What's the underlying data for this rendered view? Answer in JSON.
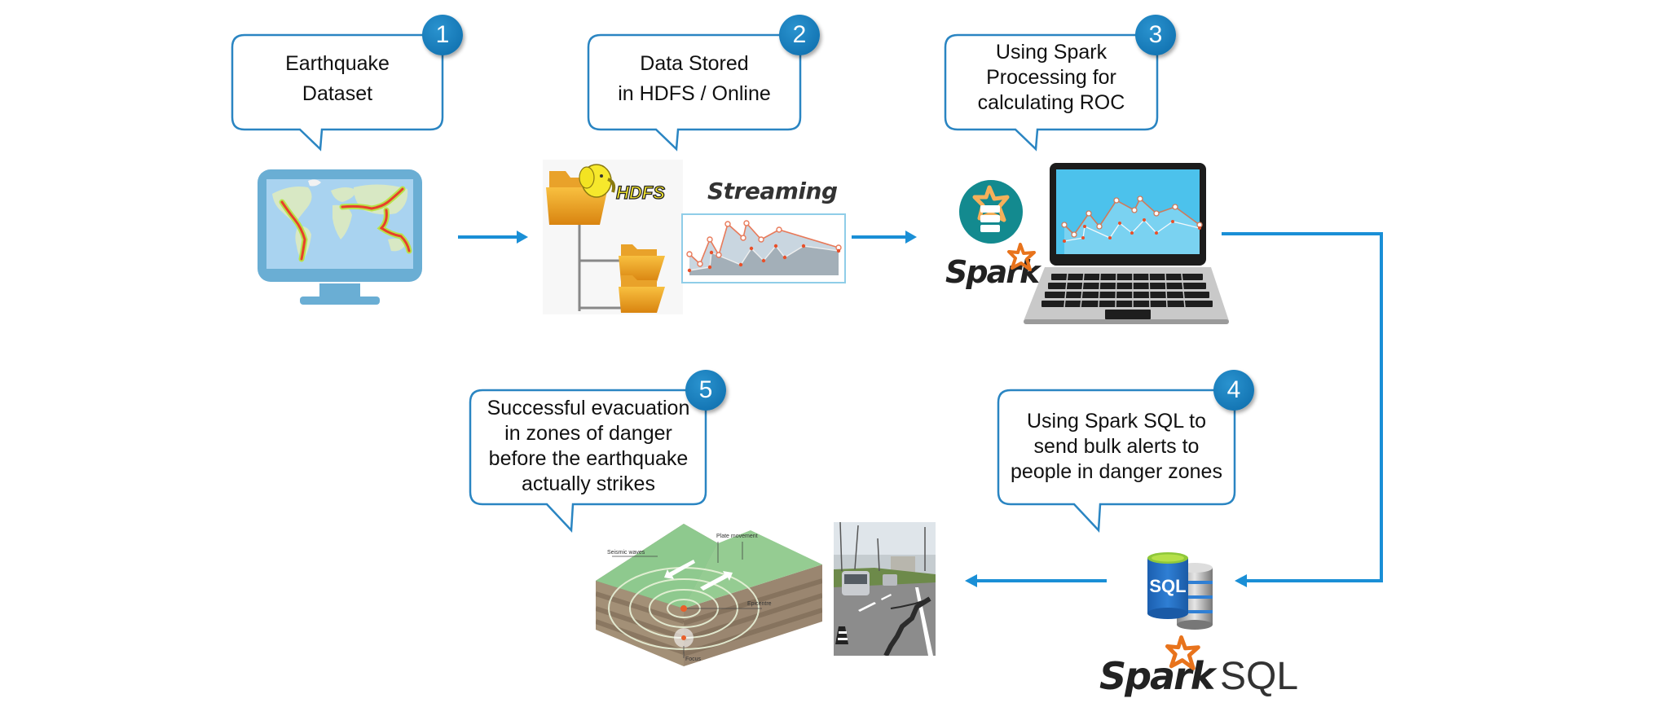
{
  "steps": [
    {
      "number": "1",
      "lines": [
        "Earthquake",
        "Dataset"
      ]
    },
    {
      "number": "2",
      "lines": [
        "Data Stored",
        "in HDFS / Online"
      ]
    },
    {
      "number": "3",
      "lines": [
        "Using Spark",
        "Processing for",
        "calculating ROC"
      ]
    },
    {
      "number": "4",
      "lines": [
        "Using Spark SQL to",
        "send bulk alerts to",
        "people in danger zones"
      ]
    },
    {
      "number": "5",
      "lines": [
        "Successful evacuation",
        "in zones of danger",
        "before the earthquake",
        "actually strikes"
      ]
    }
  ],
  "labels": {
    "hdfs": "HDFS",
    "streaming": "Streaming",
    "spark": "Spark",
    "spark_sql_spark": "Spark",
    "spark_sql_sql": "SQL",
    "sql_db": "SQL"
  },
  "quake_diagram": {
    "plate_movement": "Plate movement",
    "seismic_waves": "Seismic waves",
    "epicentre": "Epicentre",
    "focus": "Focus"
  },
  "icons": {
    "monitor": "monitor-world-map-icon",
    "hdfs": "hdfs-folder-icon",
    "streaming_chart": "streaming-chart-icon",
    "spark_logo": "spark-logo-icon",
    "laptop": "laptop-chart-icon",
    "sql_db": "sql-database-icon",
    "quake": "earthquake-diagram-icon",
    "road_photo": "cracked-road-photo"
  },
  "colors": {
    "accent": "#1a8fd6",
    "bubble_border": "#2a85c2",
    "badge": "#1577b5",
    "monitor": "#6aaed4",
    "spark_orange": "#e8731c",
    "folder": "#f0a82a"
  }
}
